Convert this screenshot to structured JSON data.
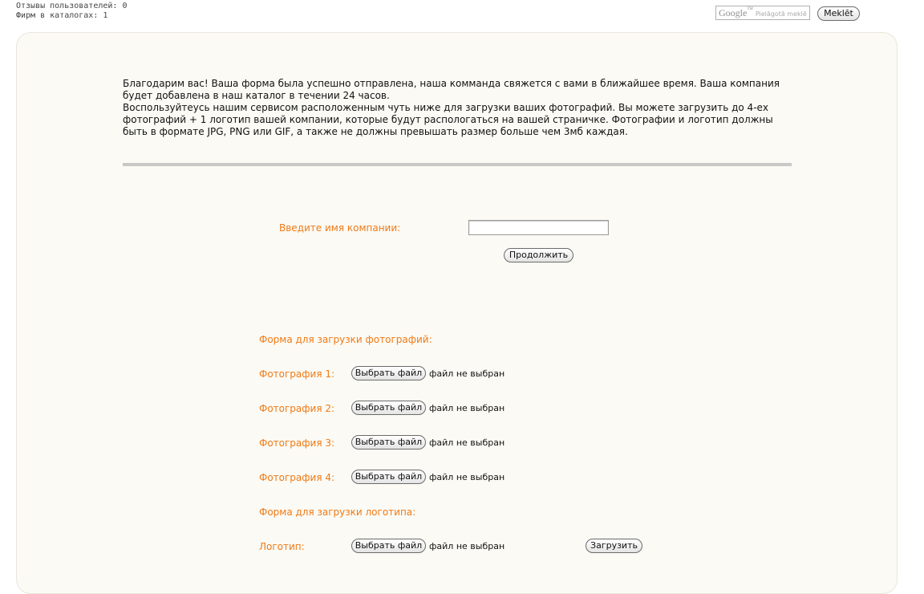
{
  "header": {
    "stats": [
      "Отзывы пользователей: 0",
      "Фирм в каталогах: 1"
    ],
    "search": {
      "logo": "Google",
      "logo_tm": "TM",
      "placeholder": "Pielāgotā meklē",
      "button_label": "Meklēt"
    }
  },
  "intro": {
    "paragraph1": "Благодарим вас! Ваша форма была успешно отправлена, наша комманда свяжется с вами в ближайшее время. Ваша компания будет добавлена в наш каталог в течении 24 часов.",
    "paragraph2": "Воспользуйтеусь нашим сервисом расположенным чуть ниже для загрузки ваших фотографий. Вы можете загрузить до 4-ех фотографий + 1 логотип вашей компании, которые будут распологаться на вашей страничке. Фотографии и логотип должны быть в формате JPG, PNG или GIF, а также не должны превышать размер больше чем 3мб каждая."
  },
  "company_form": {
    "label": "Введите имя компании:",
    "input_value": "",
    "continue_label": "Продолжить"
  },
  "photo_form": {
    "heading": "Форма для загрузки фотографий:",
    "rows": [
      {
        "label": "Фотография 1:",
        "button": "Выбрать файл",
        "status": "файл не выбран"
      },
      {
        "label": "Фотография 2:",
        "button": "Выбрать файл",
        "status": "файл не выбран"
      },
      {
        "label": "Фотография 3:",
        "button": "Выбрать файл",
        "status": "файл не выбран"
      },
      {
        "label": "Фотография 4:",
        "button": "Выбрать файл",
        "status": "файл не выбран"
      }
    ]
  },
  "logo_form": {
    "heading": "Форма для загрузки логотипа:",
    "row": {
      "label": "Логотип:",
      "button": "Выбрать файл",
      "status": "файл не выбран"
    },
    "upload_label": "Загрузить"
  },
  "colors": {
    "accent_orange": "#f07a17",
    "panel_background": "#fbfaf4",
    "divider": "#c8c8c8"
  }
}
